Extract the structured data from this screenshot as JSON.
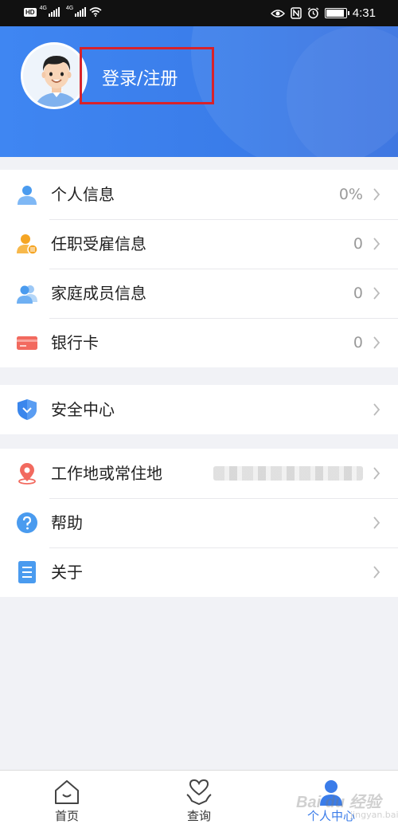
{
  "status_bar": {
    "hd": "HD",
    "net1": "4G",
    "net2": "4G",
    "time": "4:31",
    "icons": [
      "signal-icon",
      "wifi-icon",
      "eye-icon",
      "nfc-icon",
      "alarm-icon",
      "battery-icon"
    ]
  },
  "header": {
    "login_label": "登录/注册",
    "accent": "#3a7ce9",
    "highlight": "#d8222a"
  },
  "section1": [
    {
      "label": "个人信息",
      "value": "0%",
      "icon": "person-icon"
    },
    {
      "label": "任职受雇信息",
      "value": "0",
      "icon": "employment-icon"
    },
    {
      "label": "家庭成员信息",
      "value": "0",
      "icon": "family-icon"
    },
    {
      "label": "银行卡",
      "value": "0",
      "icon": "bank-card-icon"
    }
  ],
  "section2": [
    {
      "label": "安全中心",
      "icon": "shield-icon"
    }
  ],
  "section3": [
    {
      "label": "工作地或常住地",
      "icon": "location-pin-icon"
    },
    {
      "label": "帮助",
      "icon": "help-icon"
    },
    {
      "label": "关于",
      "icon": "document-icon"
    }
  ],
  "bottom_nav": [
    {
      "label": "首页",
      "icon": "home-icon"
    },
    {
      "label": "查询",
      "icon": "heart-hand-icon"
    },
    {
      "label": "个人中心",
      "icon": "profile-icon",
      "active": true
    }
  ],
  "watermark": "Bai du 经验",
  "watermark_sub": "jingyan.baidu.com"
}
